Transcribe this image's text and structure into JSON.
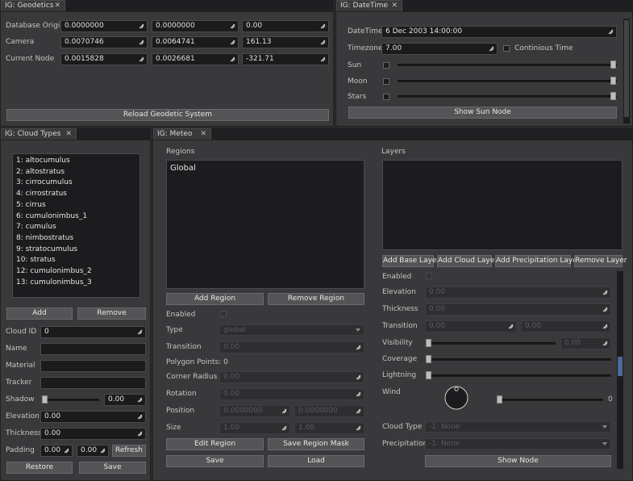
{
  "geodetics": {
    "tab": "IG: Geodetics",
    "rows": [
      {
        "label": "Database Origin",
        "v1": "0.0000000",
        "v2": "0.0000000",
        "v3": "0.00"
      },
      {
        "label": "Camera",
        "v1": "0.0070746",
        "v2": "0.0064741",
        "v3": "161.13"
      },
      {
        "label": "Current Node",
        "v1": "0.0015828",
        "v2": "0.0026681",
        "v3": "-321.71"
      }
    ],
    "reload": "Reload Geodetic System"
  },
  "datetime": {
    "tab": "IG: DateTime",
    "datetime_label": "DateTime",
    "datetime_value": "6 Dec 2003 14:00:00",
    "timezone_label": "Timezone",
    "timezone_value": "7.00",
    "continuous_label": "Continious Time",
    "sun": "Sun",
    "moon": "Moon",
    "stars": "Stars",
    "show_sun": "Show Sun Node"
  },
  "cloud_types": {
    "tab": "IG: Cloud Types",
    "items": [
      "1: altocumulus",
      "2: altostratus",
      "3: cirrocumulus",
      "4: cirrostratus",
      "5: cirrus",
      "6: cumulonimbus_1",
      "7: cumulus",
      "8: nimbostratus",
      "9: stratocumulus",
      "10: stratus",
      "12: cumulonimbus_2",
      "13: cumulonimbus_3"
    ],
    "add": "Add",
    "remove": "Remove",
    "cloud_id_label": "Cloud ID",
    "cloud_id": "0",
    "name_label": "Name",
    "material_label": "Material",
    "tracker_label": "Tracker",
    "shadow_label": "Shadow",
    "shadow": "0.00",
    "elevation_label": "Elevation",
    "elevation": "0.00",
    "thickness_label": "Thickness",
    "thickness": "0.00",
    "padding_label": "Padding",
    "padding1": "0.00",
    "padding2": "0.00",
    "refresh": "Refresh",
    "restore": "Restore",
    "save": "Save"
  },
  "meteo": {
    "tab": "IG: Meteo",
    "regions_title": "Regions",
    "regions": [
      "Global"
    ],
    "add_region": "Add Region",
    "remove_region": "Remove Region",
    "enabled_label": "Enabled",
    "type_label": "Type",
    "type_value": "global",
    "transition_label": "Transition",
    "transition": "0.00",
    "polygon_points": "Polygon Points: 0",
    "corner_radius_label": "Corner Radius",
    "corner_radius": "0.00",
    "rotation_label": "Rotation",
    "rotation": "0.00",
    "position_label": "Position",
    "pos1": "0.0000000",
    "pos2": "0.0000000",
    "size_label": "Size",
    "size1": "1.00",
    "size2": "1.00",
    "edit_region": "Edit Region",
    "save_mask": "Save Region Mask",
    "save": "Save",
    "load": "Load",
    "layers_title": "Layers",
    "add_base": "Add Base Layer",
    "add_cloud": "Add Cloud Layer",
    "add_precip": "Add Precipitation Layer",
    "remove_layer": "Remove Layer",
    "l_enabled": "Enabled",
    "l_elevation": "Elevation",
    "l_elevation_v": "0.00",
    "l_thickness": "Thickness",
    "l_thickness_v": "0.00",
    "l_transition": "Transition",
    "l_transition_v1": "0.00",
    "l_transition_v2": "0.00",
    "l_visibility": "Visibility",
    "l_visibility_v": "0.00",
    "l_coverage": "Coverage",
    "l_lightning": "Lightning",
    "l_wind": "Wind",
    "l_wind_v": "0",
    "l_cloud_type": "Cloud Type",
    "l_cloud_type_v": "-1: None",
    "l_precipitation": "Precipitation",
    "l_precipitation_v": "-1: None",
    "show_node": "Show Node"
  }
}
